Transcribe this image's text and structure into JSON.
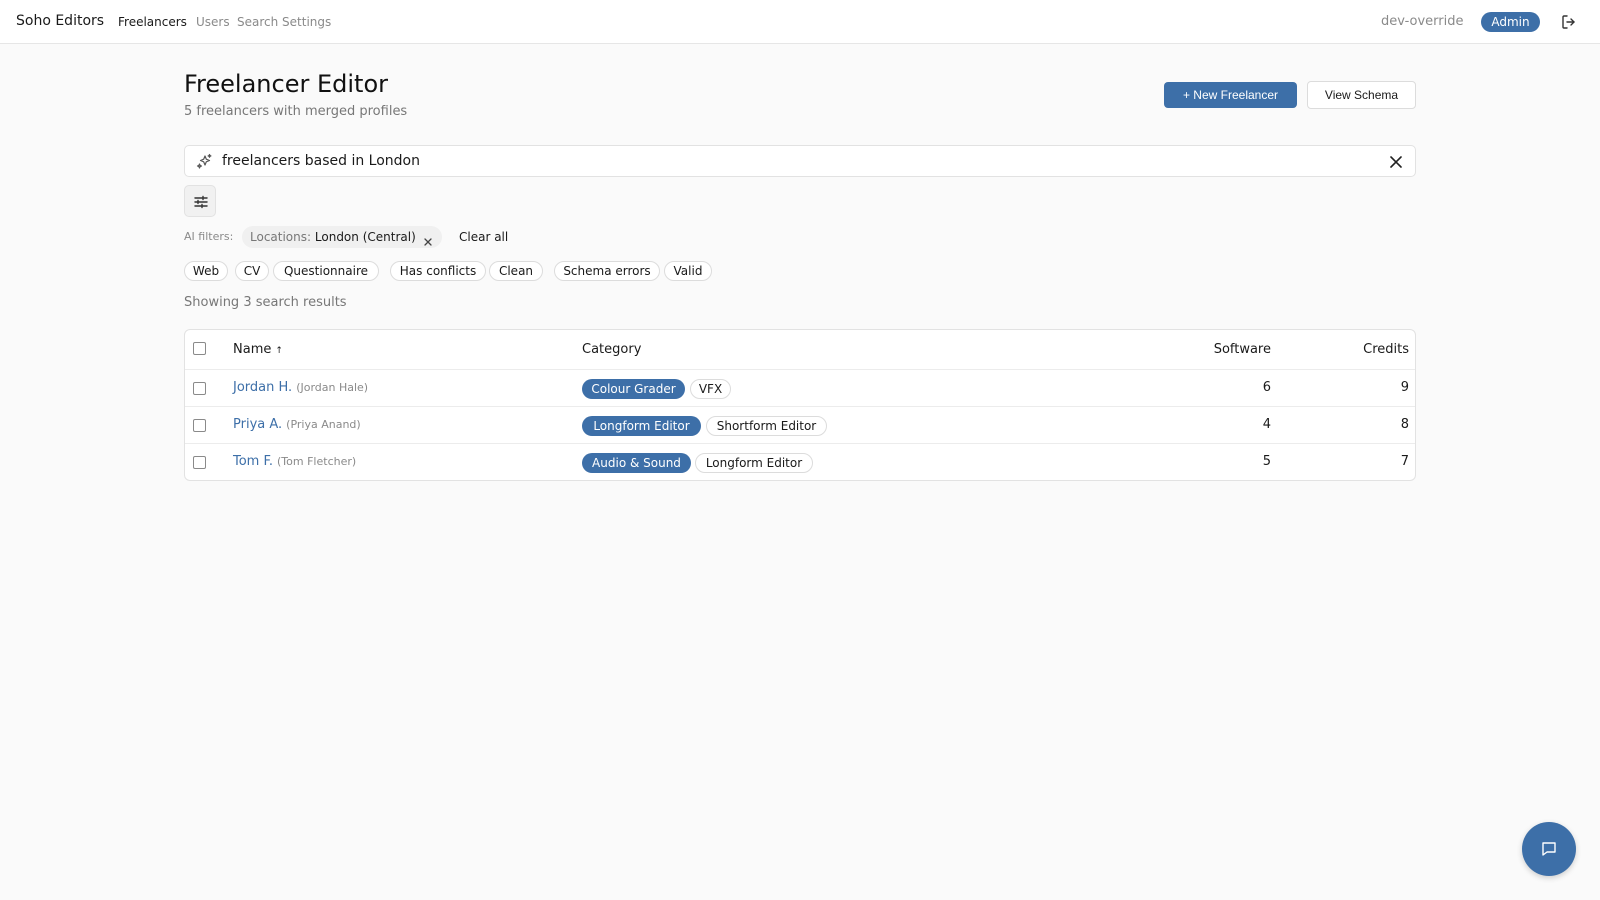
{
  "nav": {
    "brand": "Soho Editors",
    "links": [
      {
        "label": "Freelancers",
        "active": true
      },
      {
        "label": "Users",
        "active": false
      },
      {
        "label": "Search Settings",
        "active": false
      }
    ],
    "env": "dev-override",
    "role_badge": "Admin",
    "logout_icon": "logout-icon"
  },
  "header": {
    "title": "Freelancer Editor",
    "subtitle": "5 freelancers with merged profiles",
    "new_button": "+ New Freelancer",
    "schema_button": "View Schema"
  },
  "search": {
    "value": "freelancers based in London",
    "icon": "sparkle-icon",
    "clear_icon": "close-icon"
  },
  "filters": {
    "toggle_icon": "sliders-icon",
    "ai_label": "AI filters:",
    "ai_chips": [
      {
        "key": "Locations:",
        "value": "London (Central)"
      }
    ],
    "clear_all": "Clear all",
    "quick_chips": [
      "Web",
      "CV",
      "Questionnaire",
      "Has conflicts",
      "Clean",
      "Schema errors",
      "Valid"
    ]
  },
  "results": {
    "count_text": "Showing 3 search results"
  },
  "table": {
    "columns": {
      "name": "Name",
      "category": "Category",
      "software": "Software",
      "credits": "Credits"
    },
    "sort_indicator": "↑",
    "rows": [
      {
        "short": "Jordan H.",
        "full": "(Jordan Hale)",
        "tags": [
          "Colour Grader",
          "VFX"
        ],
        "software": "6",
        "credits": "9"
      },
      {
        "short": "Priya A.",
        "full": "(Priya Anand)",
        "tags": [
          "Longform Editor",
          "Shortform Editor"
        ],
        "software": "4",
        "credits": "8"
      },
      {
        "short": "Tom F.",
        "full": "(Tom Fletcher)",
        "tags": [
          "Audio & Sound",
          "Longform Editor"
        ],
        "software": "5",
        "credits": "7"
      }
    ]
  },
  "chat": {
    "icon": "chat-icon"
  },
  "colors": {
    "accent": "#3d6fa8",
    "background": "#fafafa"
  }
}
